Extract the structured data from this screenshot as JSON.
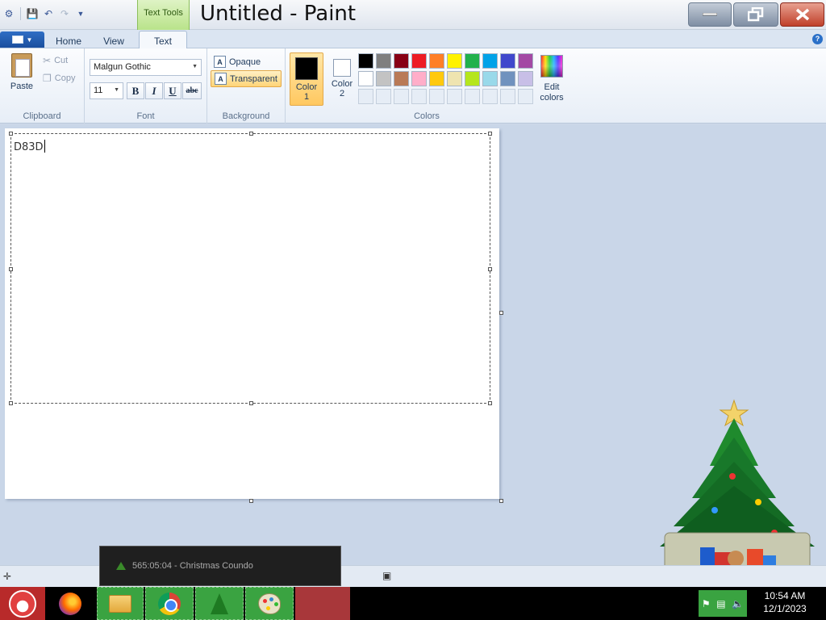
{
  "window": {
    "title": "Untitled - Paint",
    "contextual_tab_group": "Text Tools"
  },
  "tabs": [
    {
      "label": "Home"
    },
    {
      "label": "View"
    },
    {
      "label": "Text",
      "active": true
    }
  ],
  "ribbon": {
    "clipboard": {
      "group_label": "Clipboard",
      "paste": "Paste",
      "cut": "Cut",
      "copy": "Copy"
    },
    "font": {
      "group_label": "Font",
      "family": "Malgun Gothic",
      "size": "11",
      "bold": "B",
      "italic": "I",
      "underline": "U",
      "strikethrough": "abc"
    },
    "background": {
      "group_label": "Background",
      "opaque": "Opaque",
      "transparent": "Transparent",
      "selected": "transparent"
    },
    "colors": {
      "group_label": "Colors",
      "color1_label": "Color",
      "color1_num": "1",
      "color1_value": "#000000",
      "color2_label": "Color",
      "color2_num": "2",
      "color2_value": "#ffffff",
      "edit_colors_line1": "Edit",
      "edit_colors_line2": "colors",
      "palette": [
        "#000000",
        "#7f7f7f",
        "#880015",
        "#ed1c24",
        "#ff7f27",
        "#fff200",
        "#22b14c",
        "#00a2e8",
        "#3f48cc",
        "#a349a4",
        "#ffffff",
        "#c3c3c3",
        "#b97a57",
        "#ffaec9",
        "#ffc90e",
        "#efe4b0",
        "#b5e61d",
        "#99d9ea",
        "#7092be",
        "#c8bfe7",
        "",
        "",
        "",
        "",
        "",
        "",
        "",
        "",
        "",
        ""
      ]
    }
  },
  "canvas": {
    "text_content": "D83D"
  },
  "taskbar": {
    "preview_text": "565:05:04 - Christmas Coundo",
    "clock_time": "10:54 AM",
    "clock_date": "12/1/2023"
  }
}
